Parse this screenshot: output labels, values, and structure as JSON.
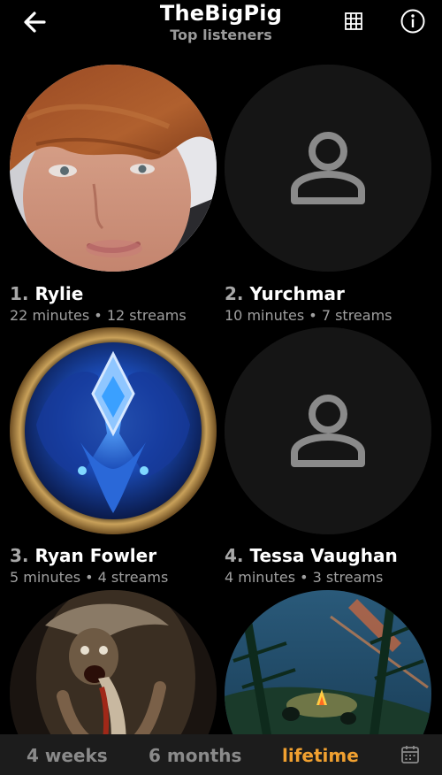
{
  "header": {
    "title": "TheBigPig",
    "subtitle": "Top listeners",
    "back_icon": "arrow-left-icon",
    "grid_icon": "grid-icon",
    "info_icon": "info-icon"
  },
  "listeners": [
    {
      "rank": "1.",
      "name": "Rylie",
      "stats": "22 minutes • 12 streams",
      "avatar": "photo"
    },
    {
      "rank": "2.",
      "name": "Yurchmar",
      "stats": "10 minutes • 7 streams",
      "avatar": "default-person-icon"
    },
    {
      "rank": "3.",
      "name": "Ryan Fowler",
      "stats": "5 minutes • 4 streams",
      "avatar": "game-emblem"
    },
    {
      "rank": "4.",
      "name": "Tessa Vaughan",
      "stats": "4 minutes • 3 streams",
      "avatar": "default-person-icon"
    },
    {
      "rank": "",
      "name": "",
      "stats": "",
      "avatar": "painting"
    },
    {
      "rank": "",
      "name": "",
      "stats": "",
      "avatar": "forest-campfire"
    }
  ],
  "time_range": {
    "tabs": [
      "4 weeks",
      "6 months",
      "lifetime"
    ],
    "selected": "lifetime",
    "calendar_icon": "calendar-icon"
  },
  "colors": {
    "background": "#000000",
    "accent": "#f0a030",
    "muted_text": "#a0a0a0",
    "bar": "#1c1c1c"
  }
}
